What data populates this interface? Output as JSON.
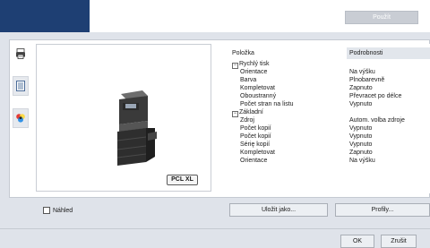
{
  "toolbar": {
    "apply_label": "Použít"
  },
  "side_tabs": [
    {
      "icon": "printer-document-icon"
    },
    {
      "icon": "layout-list-icon"
    },
    {
      "icon": "color-palette-icon"
    }
  ],
  "preview": {
    "badge": "PCL XL"
  },
  "table": {
    "headers": {
      "item": "Položka",
      "detail": "Podrobnosti"
    },
    "rows": [
      {
        "type": "group",
        "label": "Rychlý tisk",
        "value": ""
      },
      {
        "type": "child",
        "label": "Orientace",
        "value": "Na výšku"
      },
      {
        "type": "child",
        "label": "Barva",
        "value": "Plnobarevně"
      },
      {
        "type": "child",
        "label": "Kompletovat",
        "value": "Zapnuto"
      },
      {
        "type": "child",
        "label": "Oboustranný",
        "value": "Převracet po délce"
      },
      {
        "type": "child",
        "label": "Počet stran na listu",
        "value": "Vypnuto"
      },
      {
        "type": "group",
        "label": "Základní",
        "value": ""
      },
      {
        "type": "child",
        "label": "Zdroj",
        "value": "Autom. volba zdroje"
      },
      {
        "type": "child",
        "label": "Počet kopií",
        "value": "Vypnuto"
      },
      {
        "type": "child",
        "label": "Počet kopií",
        "value": "Vypnuto"
      },
      {
        "type": "child",
        "label": "Sérię kopií",
        "value": "Vypnuto"
      },
      {
        "type": "child",
        "label": "Kompletovat",
        "value": "Zapnuto"
      },
      {
        "type": "child",
        "label": "Orientace",
        "value": "Na výšku"
      }
    ]
  },
  "footer": {
    "preview_checkbox_label": "Náhled",
    "save_as_label": "Uložit jako...",
    "profiles_label": "Profily...",
    "ok_label": "OK",
    "cancel_label": "Zrušit"
  }
}
